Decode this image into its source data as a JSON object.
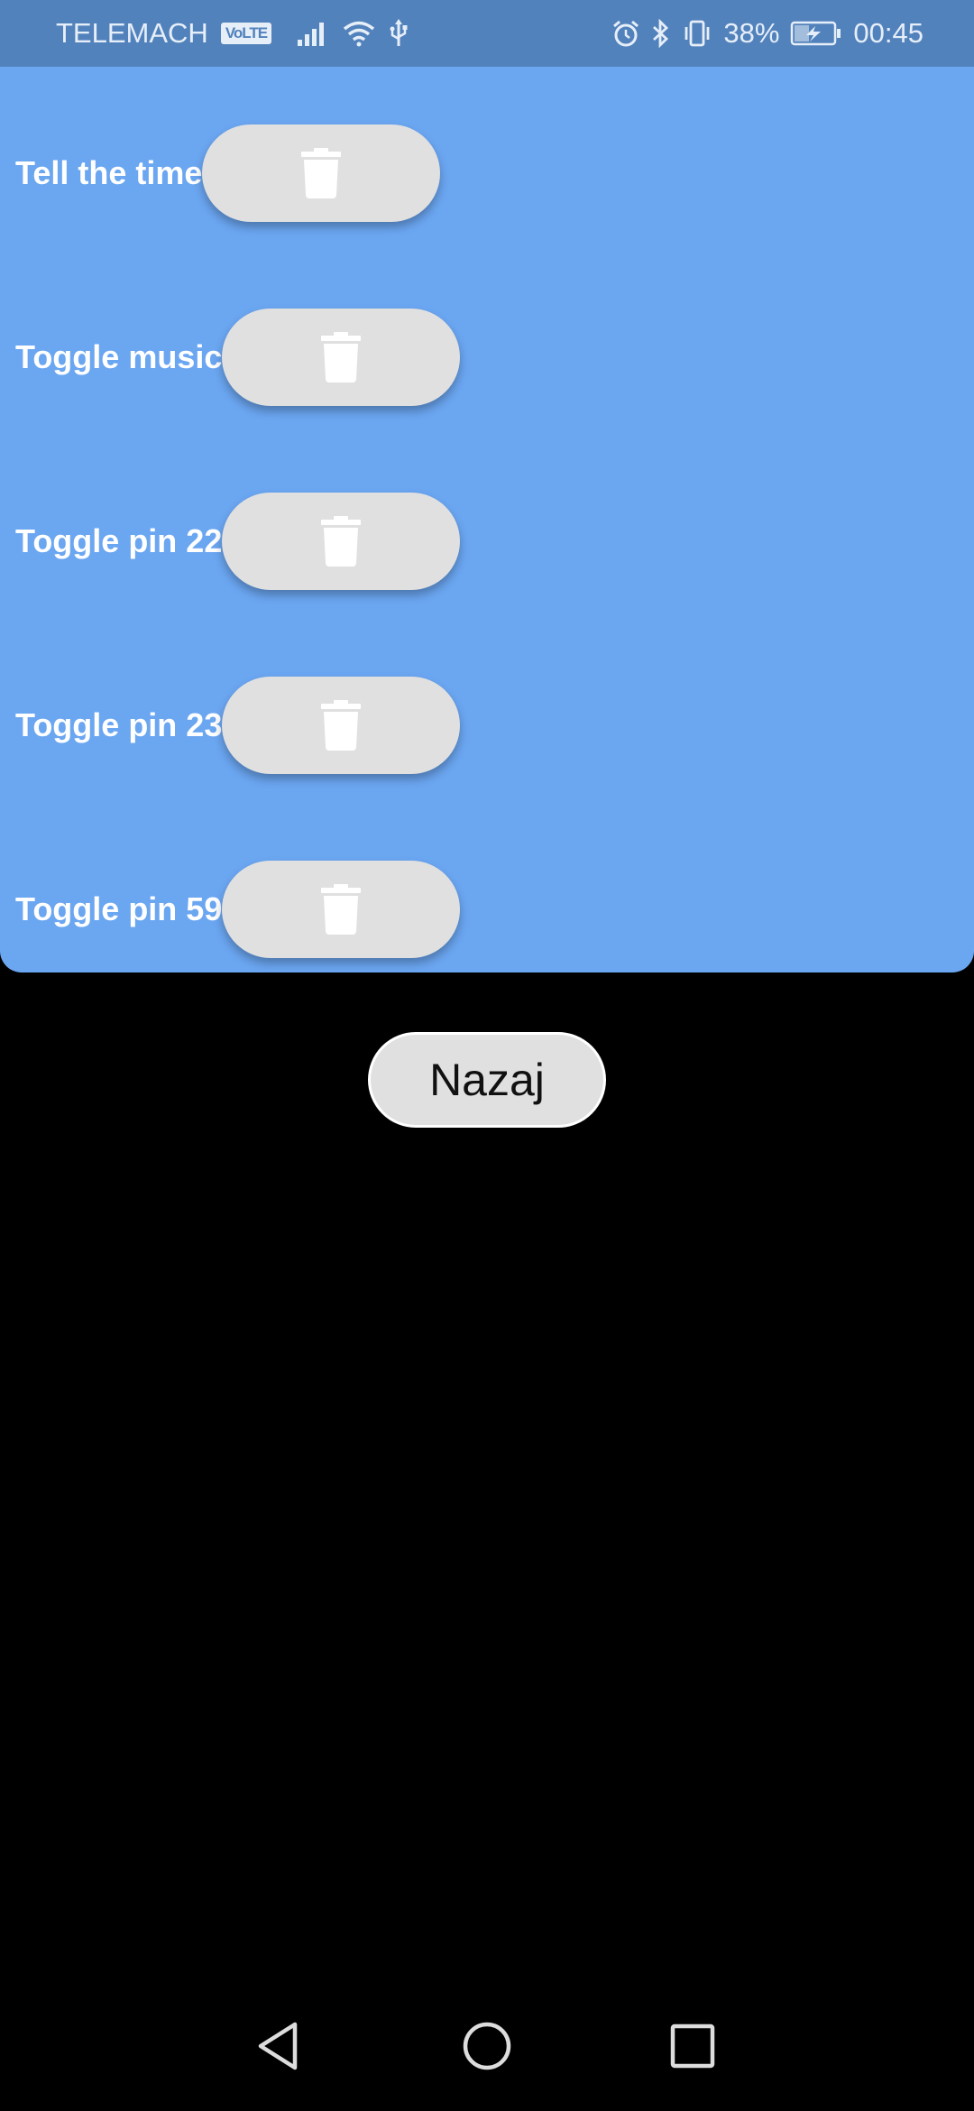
{
  "status_bar": {
    "carrier": "TELEMACH",
    "volte": "VoLTE",
    "battery": "38%",
    "time": "00:45",
    "icons": [
      "signal-icon",
      "wifi-icon",
      "usb-icon",
      "alarm-icon",
      "bluetooth-icon",
      "vibrate-icon",
      "battery-charging-icon"
    ]
  },
  "commands": {
    "items": [
      {
        "label": "Tell the time",
        "action_icon": "trash-icon"
      },
      {
        "label": "Toggle music",
        "action_icon": "trash-icon"
      },
      {
        "label": "Toggle pin 22",
        "action_icon": "trash-icon"
      },
      {
        "label": "Toggle pin 23",
        "action_icon": "trash-icon"
      },
      {
        "label": "Toggle pin 59",
        "action_icon": "trash-icon"
      }
    ]
  },
  "back_button": {
    "label": "Nazaj"
  },
  "navigation": {
    "icons": [
      "back-triangle-icon",
      "home-circle-icon",
      "recents-square-icon"
    ]
  },
  "colors": {
    "status_bar": "#5282bc",
    "panel": "#6ba6f1",
    "button": "#e0e0e0",
    "background": "#000000",
    "text_light": "#ffffff"
  }
}
